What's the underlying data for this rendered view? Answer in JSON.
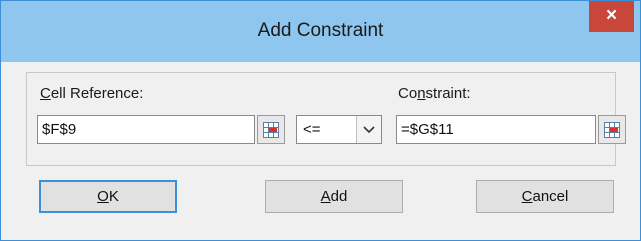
{
  "dialog": {
    "title": "Add Constraint",
    "close_label": "×"
  },
  "cell_reference": {
    "label_prefix": "",
    "label_accel": "C",
    "label_rest": "ell Reference:",
    "value": "$F$9"
  },
  "operator": {
    "selected": "<="
  },
  "constraint": {
    "label_prefix": "Co",
    "label_accel": "n",
    "label_rest": "straint:",
    "value": "=$G$11"
  },
  "buttons": {
    "ok_accel": "O",
    "ok_rest": "K",
    "add_accel": "A",
    "add_rest": "dd",
    "cancel_accel": "C",
    "cancel_rest": "ancel"
  },
  "colors": {
    "titlebar": "#8fc6ef",
    "close": "#c8463a",
    "default_button_border": "#3c8fd6"
  }
}
